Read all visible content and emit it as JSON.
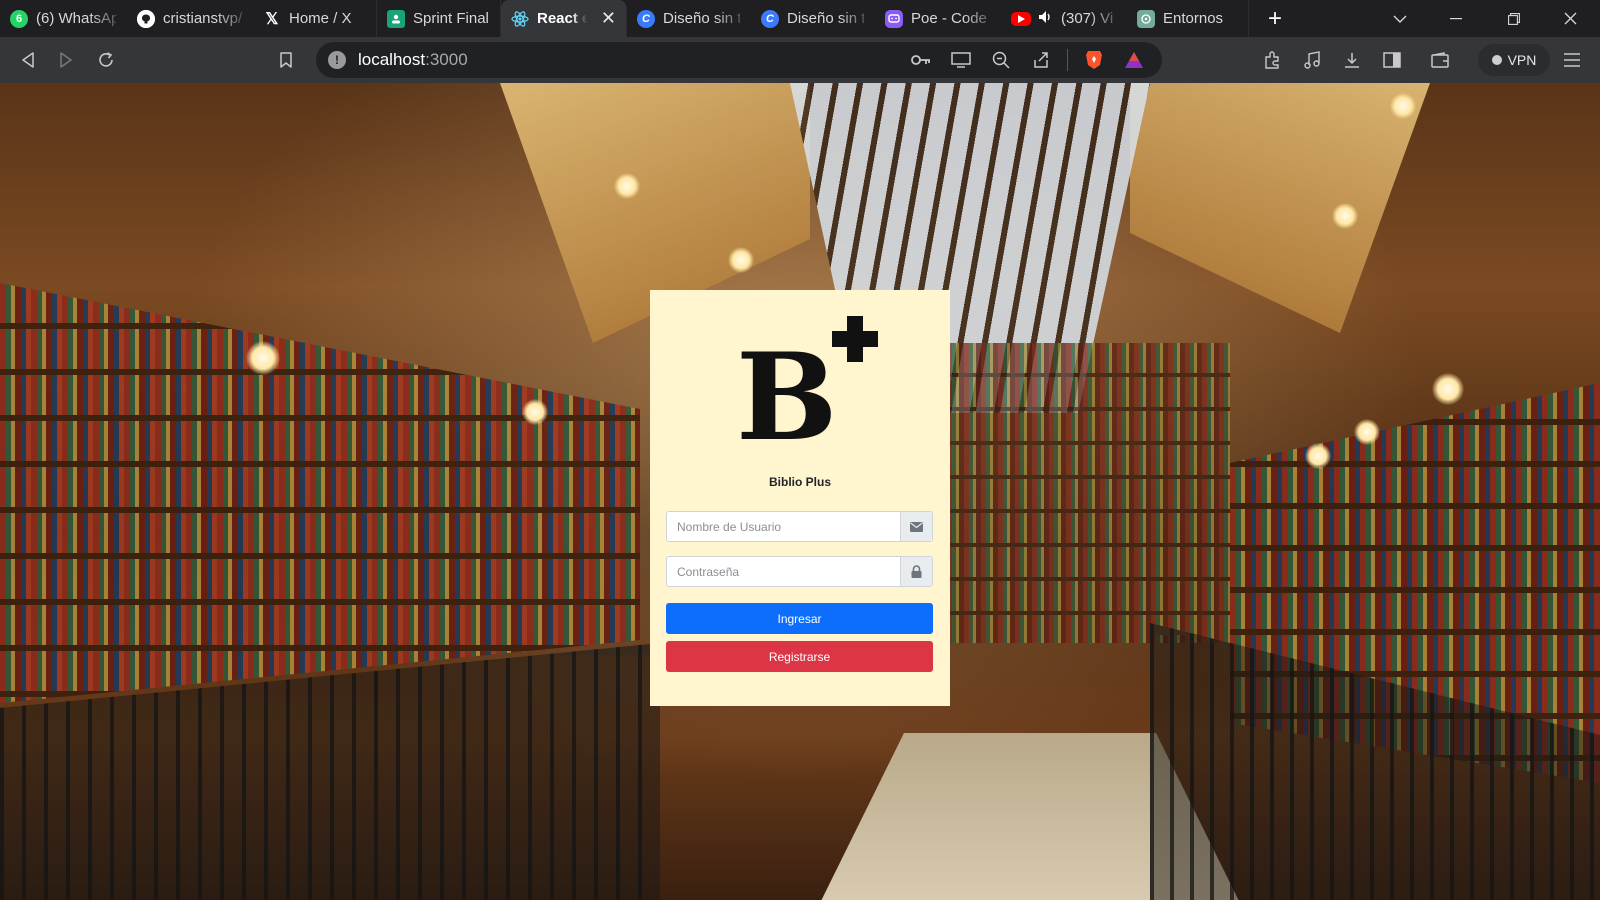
{
  "browser": {
    "tabs": [
      {
        "title": "(6) WhatsAp",
        "icon": "whatsapp-icon",
        "badge": "6",
        "color": "#25d366",
        "active": false
      },
      {
        "title": "cristianstvp/",
        "icon": "github-icon",
        "color": "#ffffff",
        "active": false
      },
      {
        "title": "Home / X",
        "icon": "x-icon",
        "color": "#ffffff",
        "active": false
      },
      {
        "title": "Sprint Final",
        "icon": "classroom-icon",
        "color": "#1aa37a",
        "active": false
      },
      {
        "title": "React e",
        "icon": "react-icon",
        "color": "#61dafb",
        "active": true
      },
      {
        "title": "Diseño sin t",
        "icon": "canva-icon",
        "color": "#3a7bfd",
        "active": false
      },
      {
        "title": "Diseño sin t",
        "icon": "canva-icon",
        "color": "#3a7bfd",
        "active": false
      },
      {
        "title": "Poe - Code",
        "icon": "poe-icon",
        "color": "#8a5cf6",
        "active": false
      },
      {
        "title": "(307) Vi",
        "icon": "youtube-icon",
        "color": "#ff0000",
        "active": false
      },
      {
        "title": "Entornos",
        "icon": "chatgpt-icon",
        "color": "#74aa9c",
        "active": false
      }
    ],
    "close_tab_glyph": "✕",
    "new_tab_glyph": "+",
    "url": {
      "host": "localhost",
      "port": ":3000"
    },
    "vpn_label": "VPN"
  },
  "login": {
    "logo_letter": "B",
    "brand_name": "Biblio Plus",
    "username_placeholder": "Nombre de Usuario",
    "password_placeholder": "Contraseña",
    "login_button": "Ingresar",
    "register_button": "Registrarse",
    "colors": {
      "card": "#fff5cf",
      "primary": "#0d6efd",
      "danger": "#dc3545"
    }
  }
}
